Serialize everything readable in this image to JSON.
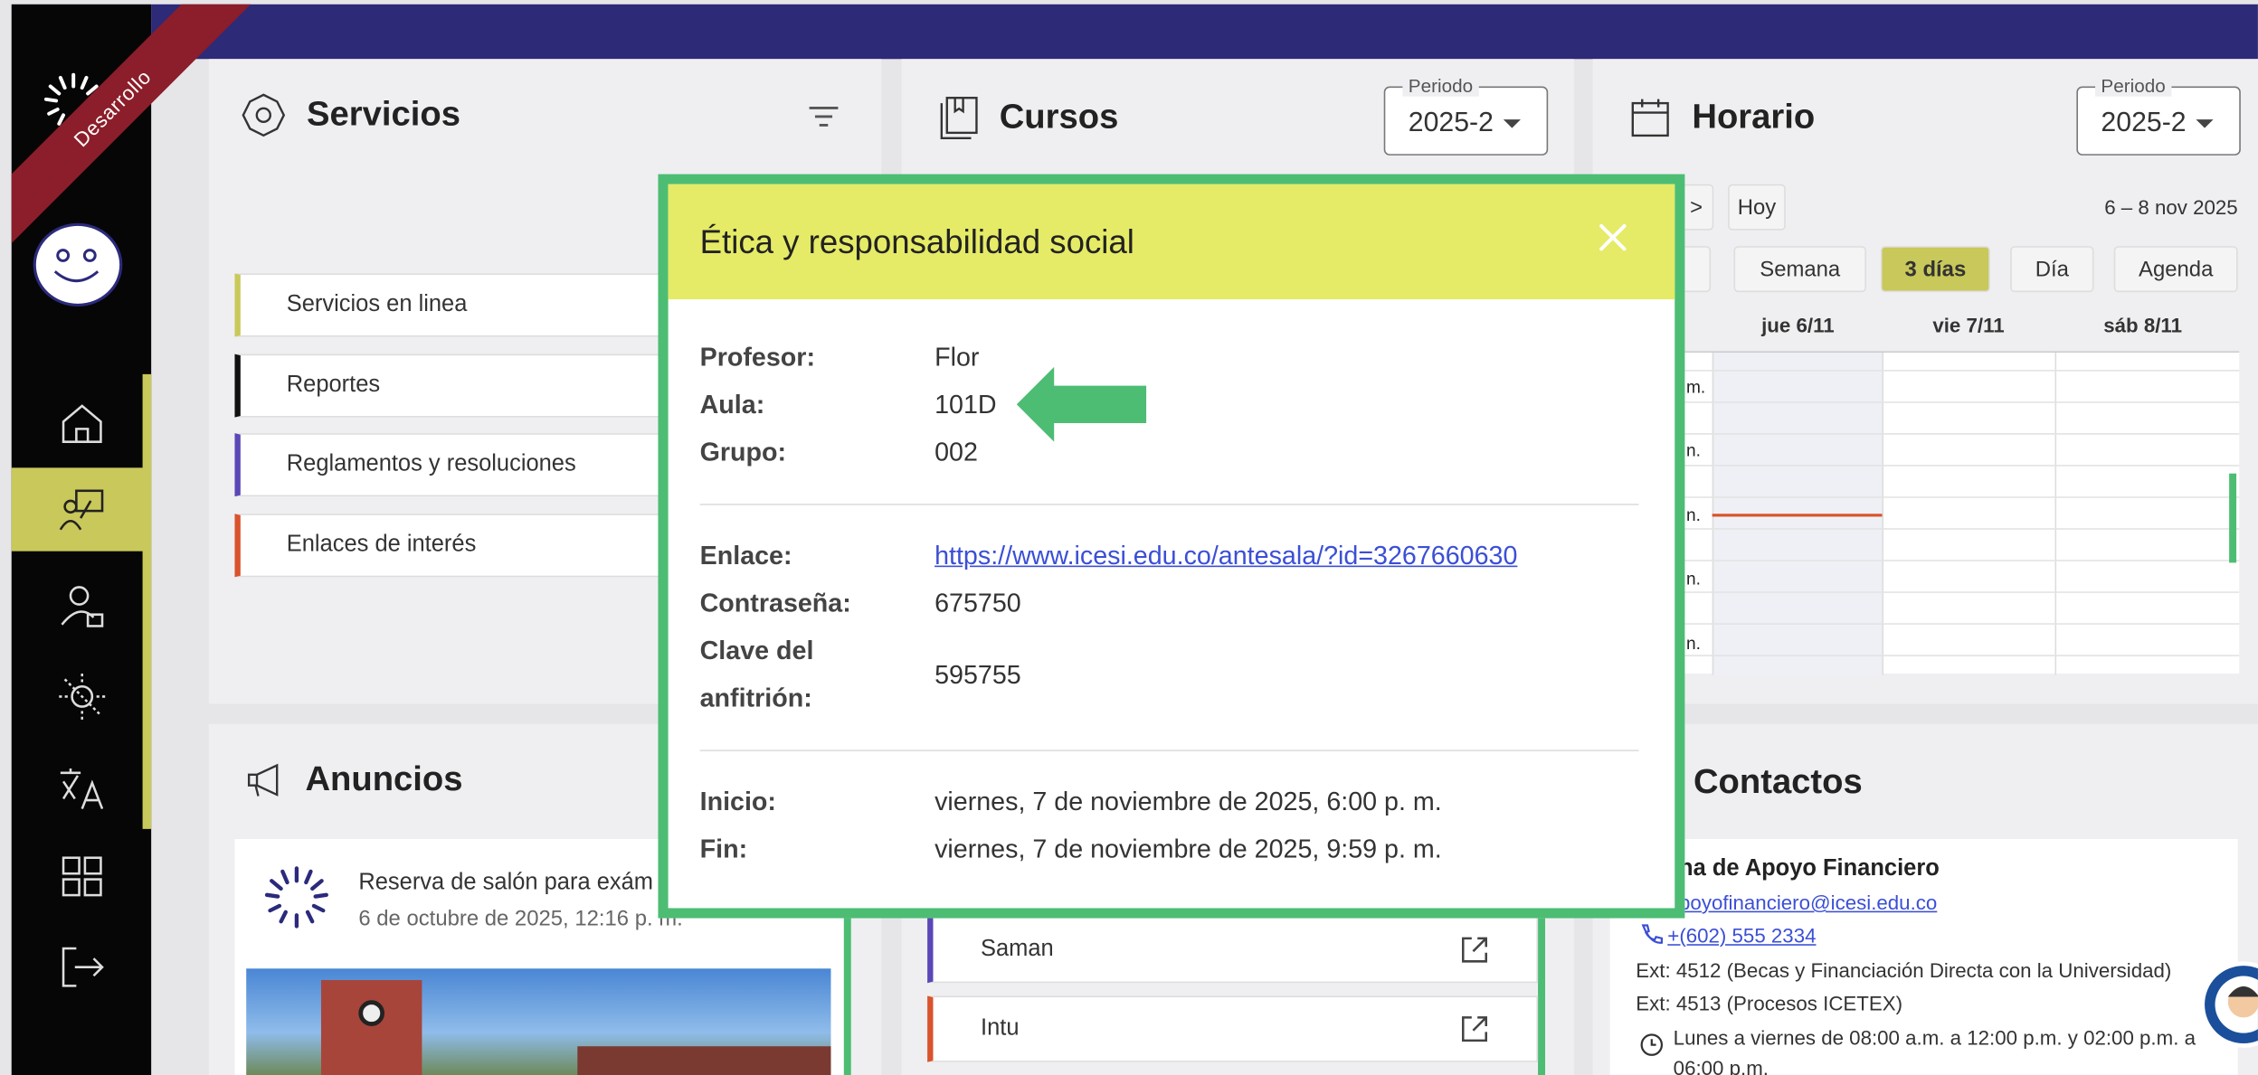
{
  "sidebar": {
    "ribbon": "Desarrollo",
    "nav": [
      "home-icon",
      "classroom-icon",
      "user-lock-icon",
      "theme-icon",
      "translate-icon",
      "apps-grid-icon",
      "logout-icon"
    ],
    "accent_color": "#c9c85a"
  },
  "servicios": {
    "title": "Servicios",
    "items": [
      {
        "label": "Servicios en linea",
        "color": "#c9c85a"
      },
      {
        "label": "Reportes",
        "color": "#111111"
      },
      {
        "label": "Reglamentos y resoluciones",
        "color": "#5b47b5"
      },
      {
        "label": "Enlaces de interés",
        "color": "#d9532c"
      }
    ]
  },
  "cursos": {
    "title": "Cursos",
    "periodo_label": "Periodo",
    "periodo_value": "2025-2",
    "links": [
      {
        "label": "Saman",
        "color": "#5b47b5"
      },
      {
        "label": "Intu",
        "color": "#d9532c"
      }
    ]
  },
  "horario": {
    "title": "Horario",
    "periodo_label": "Periodo",
    "periodo_value": "2025-2",
    "today_label": "Hoy",
    "next_label": ">",
    "date_range": "6 – 8 nov 2025",
    "views": [
      "Semana",
      "3 días",
      "Día",
      "Agenda"
    ],
    "active_view": "3 días",
    "days": [
      "jue 6/11",
      "vie 7/11",
      "sáb 8/11"
    ],
    "time_suffixes": [
      "m.",
      "n.",
      "n.",
      "n.",
      "n."
    ]
  },
  "anuncios": {
    "title": "Anuncios",
    "item_title": "Reserva de salón para exám",
    "item_date": "6 de octubre de 2025, 12:16 p. m."
  },
  "contactos": {
    "title": "Contactos",
    "office": "na de Apoyo Financiero",
    "email": "poyofinanciero@icesi.edu.co",
    "phone": "+(602) 555 2334",
    "ext1": "Ext: 4512 (Becas y Financiación Directa con la Universidad)",
    "ext2": "Ext: 4513 (Procesos ICETEX)",
    "hours": "Lunes a viernes de 08:00 a.m. a 12:00 p.m. y 02:00 p.m. a",
    "hours2": "06:00 p.m."
  },
  "modal": {
    "title": "Ética y responsabilidad social",
    "profesor_label": "Profesor:",
    "profesor": "Flor",
    "aula_label": "Aula:",
    "aula": "101D",
    "grupo_label": "Grupo:",
    "grupo": "002",
    "enlace_label": "Enlace:",
    "enlace": "https://www.icesi.edu.co/antesala/?id=3267660630",
    "contrasena_label": "Contraseña:",
    "contrasena": "675750",
    "clave_label_1": "Clave del",
    "clave_label_2": "anfitrión:",
    "clave": "595755",
    "inicio_label": "Inicio:",
    "inicio": "viernes, 7 de noviembre de 2025, 6:00 p. m.",
    "fin_label": "Fin:",
    "fin": "viernes, 7 de noviembre de 2025, 9:59 p. m.",
    "header_color": "#e5eb66",
    "border_color": "#4dbd74"
  }
}
